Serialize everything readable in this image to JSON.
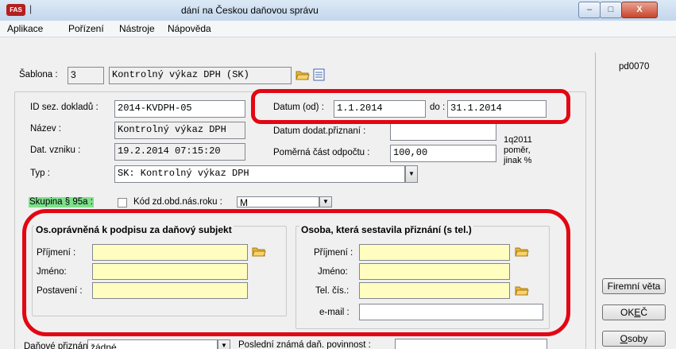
{
  "titlebar": {
    "app_icon": "FAS",
    "separator": "|",
    "title": "dání na Českou daňovou správu",
    "minimize": "–",
    "maximize": "□",
    "close": "X"
  },
  "menu": [
    "Aplikace",
    "Pořízení",
    "Nástroje",
    "Nápověda"
  ],
  "sablona": {
    "label": "Šablona :",
    "number": "3",
    "name": "Kontrolný výkaz DPH (SK)"
  },
  "right_panel": {
    "code": "pd0070",
    "firemni_veta": "Firemní věta",
    "ok": "OK",
    "ok_underline": "E",
    "ok_end": "Č",
    "osoby_first": "O",
    "osoby_rest": "soby"
  },
  "form": {
    "id_label": "ID sez. dokladů :",
    "id_value": "2014-KVDPH-05",
    "nazev_label": "Název :",
    "nazev_value": "Kontrolný výkaz DPH",
    "vznik_label": "Dat. vzniku :",
    "vznik_value": "19.2.2014 07:15:20",
    "typ_label": "Typ :",
    "typ_value": "SK: Kontrolný výkaz DPH",
    "datum_od_label": "Datum (od) :",
    "datum_od_value": "1.1.2014",
    "do_label": "do :",
    "do_value": "31.1.2014",
    "dodat_label": "Datum dodat.přiznaní :",
    "dodat_value": "",
    "pomer_label": "Poměrná část odpočtu :",
    "pomer_value": "100,00",
    "note_line1": "1q2011",
    "note_line2": "poměr,",
    "note_line3": "jinak %",
    "skupina_label": "Skupina § 95a :",
    "kod_label": "Kód zd.obd.nás.roku :",
    "kod_value": "M"
  },
  "left_group": {
    "title": "Os.oprávněná k podpisu za daňový subjekt",
    "prijmeni": "Příjmení :",
    "jmeno": "Jméno:",
    "postaveni": "Postavení :"
  },
  "right_group": {
    "title": "Osoba, která sestavila přiznání (s tel.)",
    "prijmeni": "Příjmení :",
    "jmeno": "Jméno:",
    "tel": "Tel. čís.:",
    "email": "e-mail :"
  },
  "bottom": {
    "danove_label": "Daňové přiznání :",
    "danove_value": "žádné",
    "posledni_label": "Poslední známá daň. povinnost :"
  },
  "colors": {
    "highlight": "#e30613",
    "yellow_field": "#fffdbf",
    "skupina_bg": "#7ee08a"
  }
}
